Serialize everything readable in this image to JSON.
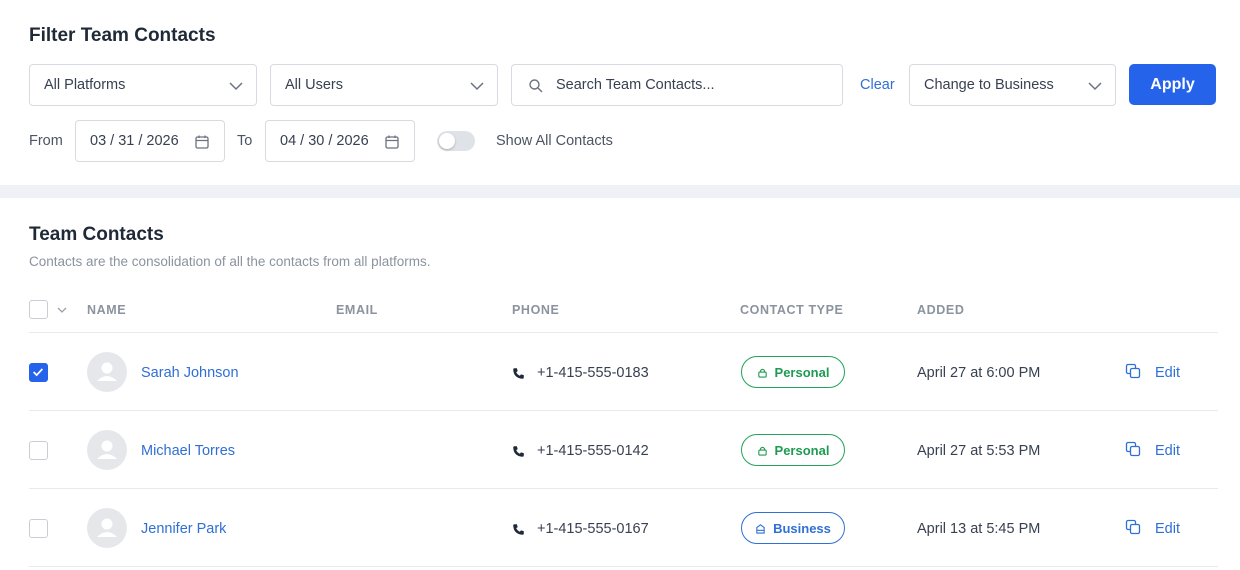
{
  "filter": {
    "title": "Filter Team Contacts",
    "platform_select": "All Platforms",
    "user_select": "All Users",
    "search_placeholder": "Search Team Contacts...",
    "clear_label": "Clear",
    "change_select": "Change to Business",
    "apply_label": "Apply",
    "from_label": "From",
    "from_date": "03 / 31 / 2026",
    "to_label": "To",
    "to_date": "04 / 30 / 2026",
    "show_all_label": "Show All Contacts",
    "show_all_on": false
  },
  "contacts": {
    "title": "Team Contacts",
    "subtitle": "Contacts are the consolidation of all the contacts from all platforms.",
    "columns": [
      "NAME",
      "EMAIL",
      "PHONE",
      "CONTACT TYPE",
      "ADDED"
    ],
    "rows": [
      {
        "name": "Sarah Johnson",
        "phone": "+1-415-555-0183",
        "type": "Personal",
        "added": "April 27 at 6:00 PM",
        "edit": "Edit",
        "checked": true
      },
      {
        "name": "Michael Torres",
        "phone": "+1-415-555-0142",
        "type": "Personal",
        "added": "April 27 at 5:53 PM",
        "edit": "Edit",
        "checked": false
      },
      {
        "name": "Jennifer Park",
        "phone": "+1-415-555-0167",
        "type": "Business",
        "added": "April 13 at 5:45 PM",
        "edit": "Edit",
        "checked": false
      }
    ]
  },
  "colors": {
    "accent": "#2563eb",
    "link": "#2f6fd6",
    "personal": "#22a25a",
    "business": "#2f6fd6",
    "band": "#eef1f5"
  },
  "icons": [
    "chevron-down-icon",
    "search-icon",
    "calendar-icon",
    "check-icon",
    "user-avatar-icon",
    "phone-icon",
    "lock-icon",
    "building-icon",
    "copy-icon"
  ]
}
